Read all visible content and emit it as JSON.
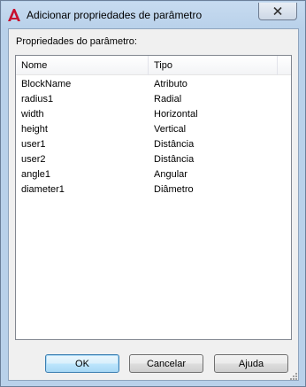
{
  "window": {
    "title": "Adicionar propriedades de parâmetro",
    "app_icon": "autocad-a-icon",
    "close_icon": "close-icon"
  },
  "group": {
    "label": "Propriedades do parâmetro:"
  },
  "list": {
    "columns": [
      "Nome",
      "Tipo"
    ],
    "rows": [
      {
        "name": "BlockName",
        "type": "Atributo"
      },
      {
        "name": "radius1",
        "type": "Radial"
      },
      {
        "name": "width",
        "type": "Horizontal"
      },
      {
        "name": "height",
        "type": "Vertical"
      },
      {
        "name": "user1",
        "type": "Distância"
      },
      {
        "name": "user2",
        "type": "Distância"
      },
      {
        "name": "angle1",
        "type": "Angular"
      },
      {
        "name": "diameter1",
        "type": "Diâmetro"
      }
    ]
  },
  "buttons": {
    "ok": "OK",
    "cancel": "Cancelar",
    "help": "Ajuda"
  },
  "colors": {
    "title_bg": "#b9d1ea",
    "dialog_bg": "#f0f0f0",
    "brand_red": "#c8102e"
  }
}
